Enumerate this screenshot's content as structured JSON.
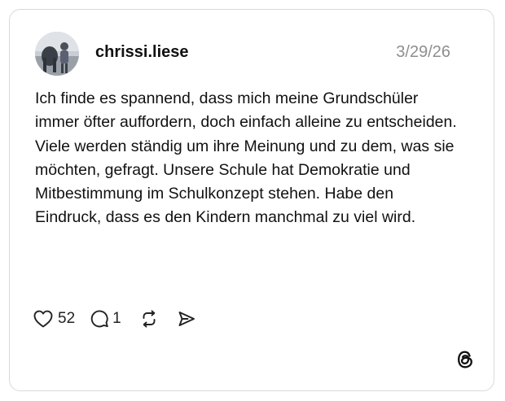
{
  "post": {
    "username": "chrissi.liese",
    "date": "3/29/26",
    "text": "Ich finde es spannend, dass mich meine Grundschüler immer öfter auffordern, doch einfach alleine zu entscheiden. Viele werden ständig um ihre Meinung und zu dem, was sie möchten, gefragt. Unsere Schule hat Demokratie und Mitbestimmung im Schulkonzept stehen. Habe den Eindruck, dass es den Kindern manchmal zu viel wird.",
    "likes": "52",
    "replies": "1"
  },
  "icons": {
    "like": "heart-icon",
    "reply": "comment-icon",
    "repost": "repost-icon",
    "share": "send-icon",
    "brand": "threads-logo-icon"
  },
  "colors": {
    "text": "#111111",
    "muted": "#8e8e8e",
    "border": "#d9d9d9"
  }
}
